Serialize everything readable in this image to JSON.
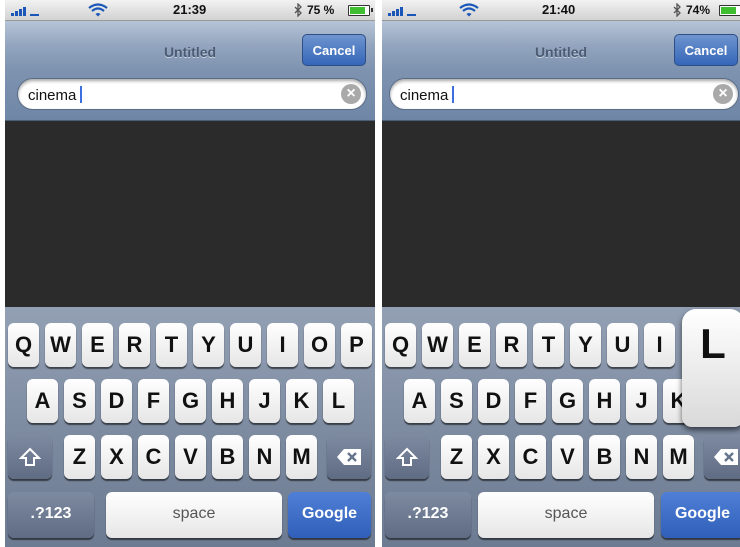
{
  "screens": [
    {
      "status": {
        "time": "21:39",
        "battery": "75 %"
      },
      "nav": {
        "title": "Untitled",
        "cancel": "Cancel"
      },
      "search": {
        "value": "cinema"
      },
      "keyboard": {
        "row1": [
          "Q",
          "W",
          "E",
          "R",
          "T",
          "Y",
          "U",
          "I",
          "O",
          "P"
        ],
        "row2": [
          "A",
          "S",
          "D",
          "F",
          "G",
          "H",
          "J",
          "K",
          "L"
        ],
        "row3": [
          "Z",
          "X",
          "C",
          "V",
          "B",
          "N",
          "M"
        ],
        "numbers": ".?123",
        "space": "space",
        "go": "Google"
      }
    },
    {
      "status": {
        "time": "21:40",
        "battery": "74%"
      },
      "nav": {
        "title": "Untitled",
        "cancel": "Cancel"
      },
      "search": {
        "value": "cinema"
      },
      "keyboard": {
        "row1": [
          "Q",
          "W",
          "E",
          "R",
          "T",
          "Y",
          "U",
          "I"
        ],
        "row2": [
          "A",
          "S",
          "D",
          "F",
          "G",
          "H",
          "J",
          "K"
        ],
        "row3": [
          "Z",
          "X",
          "C",
          "V",
          "B",
          "N",
          "M"
        ],
        "popup": "L",
        "numbers": ".?123",
        "space": "space",
        "go": "Google"
      }
    }
  ],
  "icons": {
    "signal": "signal-bars-icon",
    "wifi": "wifi-icon",
    "bluetooth": "bluetooth-icon",
    "battery": "battery-icon",
    "clear": "clear-icon",
    "shift": "shift-icon",
    "backspace": "backspace-icon"
  },
  "colors": {
    "accent": "#3466b8",
    "caret": "#3c6ee0",
    "battery_fill": "#3fbf2f"
  }
}
